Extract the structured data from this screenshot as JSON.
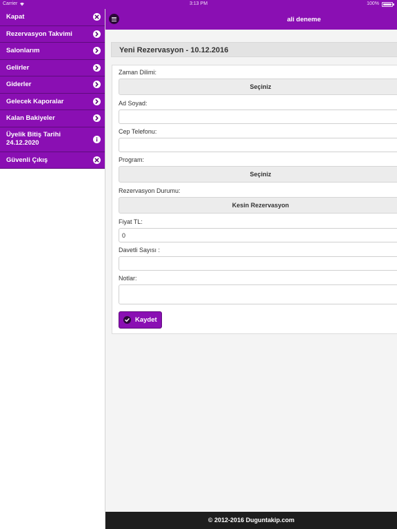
{
  "status_bar": {
    "carrier": "Carrier",
    "time": "3:13 PM",
    "battery": "100%",
    "battery_level": 1.0
  },
  "sidebar": {
    "items": [
      {
        "label": "Kapat",
        "icon": "close-icon"
      },
      {
        "label": "Rezervasyon Takvimi",
        "icon": "chevron-right-icon"
      },
      {
        "label": "Salonlarım",
        "icon": "chevron-right-icon"
      },
      {
        "label": "Gelirler",
        "icon": "chevron-right-icon"
      },
      {
        "label": "Giderler",
        "icon": "chevron-right-icon"
      },
      {
        "label": "Gelecek Kaporalar",
        "icon": "chevron-right-icon"
      },
      {
        "label": "Kalan Bakiyeler",
        "icon": "chevron-right-icon"
      },
      {
        "label_line1": "Üyelik Bitiş Tarihi",
        "label_line2": "24.12.2020",
        "icon": "info-icon"
      },
      {
        "label": "Güvenli Çıkış",
        "icon": "close-icon"
      }
    ]
  },
  "header": {
    "menu_icon": "hamburger-menu-icon",
    "user_name": "ali deneme"
  },
  "page": {
    "title": "Yeni Rezervasyon - 10.12.2016"
  },
  "form": {
    "time_slot": {
      "label": "Zaman Dilimi:",
      "value": "Seçiniz"
    },
    "full_name": {
      "label": "Ad Soyad:",
      "value": ""
    },
    "phone": {
      "label": "Cep Telefonu:",
      "value": ""
    },
    "program": {
      "label": "Program:",
      "value": "Seçiniz"
    },
    "reservation_status": {
      "label": "Rezervasyon Durumu:",
      "value": "Kesin Rezervasyon"
    },
    "price": {
      "label": "Fiyat TL:",
      "value": "0"
    },
    "guest_count": {
      "label": "Davetli Sayısı :",
      "value": ""
    },
    "notes": {
      "label": "Notlar:",
      "value": ""
    },
    "save_label": "Kaydet"
  },
  "footer": {
    "copyright": "© 2012-2016 Duguntakip.com"
  },
  "colors": {
    "brand_purple": "#8a0fb3",
    "dark_purple": "#2b0838",
    "footer_bg": "#1e1e1e"
  }
}
